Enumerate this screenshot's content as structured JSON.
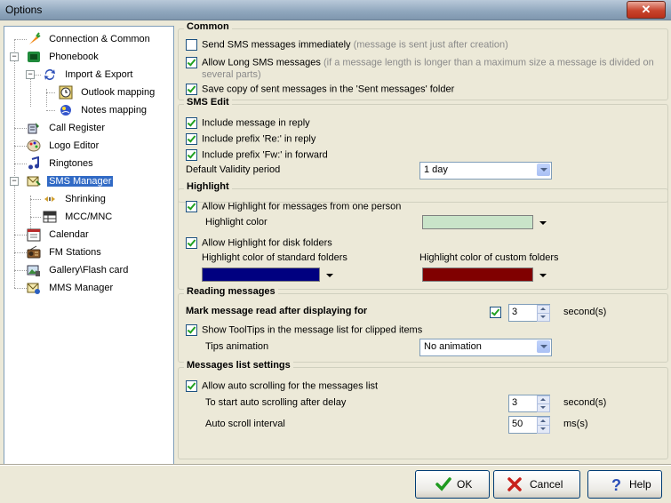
{
  "window": {
    "title": "Options",
    "close_label": "✕"
  },
  "tree": {
    "items": [
      {
        "label": "Connection & Common",
        "icon": "carrot-icon"
      },
      {
        "label": "Phonebook",
        "icon": "phonebook-icon"
      },
      {
        "label": "Import & Export",
        "icon": "sync-arrows-icon"
      },
      {
        "label": "Outlook mapping",
        "icon": "outlook-clock-icon"
      },
      {
        "label": "Notes mapping",
        "icon": "notes-globe-icon"
      },
      {
        "label": "Call Register",
        "icon": "call-register-icon"
      },
      {
        "label": "Logo Editor",
        "icon": "palette-icon"
      },
      {
        "label": "Ringtones",
        "icon": "music-note-icon"
      },
      {
        "label": "SMS Manager",
        "icon": "sms-manager-icon"
      },
      {
        "label": "Shrinking",
        "icon": "shrink-hands-icon"
      },
      {
        "label": "MCC/MNC",
        "icon": "network-table-icon"
      },
      {
        "label": "Calendar",
        "icon": "calendar-icon"
      },
      {
        "label": "FM Stations",
        "icon": "radio-icon"
      },
      {
        "label": "Gallery\\Flash card",
        "icon": "gallery-icon"
      },
      {
        "label": "MMS Manager",
        "icon": "mms-icon"
      }
    ],
    "selected": "SMS Manager"
  },
  "common": {
    "title": "Common",
    "send_immediately": "Send SMS messages immediately",
    "send_immediately_hint": "(message is sent just after creation)",
    "allow_long": "Allow Long SMS messages",
    "allow_long_hint1": "(if a message length is longer than a maximum size a message is divided on",
    "allow_long_hint2": "several parts)",
    "save_copy": "Save copy of sent messages in the 'Sent messages' folder"
  },
  "sms_edit": {
    "title": "SMS Edit",
    "include_message": "Include message in reply",
    "include_re": "Include prefix 'Re:' in reply",
    "include_fw": "Include prefix 'Fw:' in forward",
    "validity_label": "Default Validity period",
    "validity_value": "1 day"
  },
  "highlight": {
    "title": "Highlight",
    "allow_person": "Allow Highlight for messages from one person",
    "highlight_color_label": "Highlight color",
    "highlight_color": "#c9e4c9",
    "allow_disk": "Allow Highlight for disk folders",
    "standard_label": "Highlight color of standard folders",
    "standard_color": "#000080",
    "custom_label": "Highlight color of custom folders",
    "custom_color": "#800000"
  },
  "reading": {
    "title": "Reading messages",
    "mark_read": "Mark message read after displaying for",
    "mark_value": "3",
    "mark_unit": "second(s)",
    "show_tooltips": "Show ToolTips in the message list for clipped items",
    "tips_label": "Tips animation",
    "tips_value": "No animation"
  },
  "list_settings": {
    "title": "Messages list settings",
    "auto_scroll": "Allow auto scrolling for the messages list",
    "delay_label": "To start auto scrolling after delay",
    "delay_value": "3",
    "delay_unit": "second(s)",
    "interval_label": "Auto scroll interval",
    "interval_value": "50",
    "interval_unit": "ms(s)"
  },
  "buttons": {
    "ok": "OK",
    "cancel": "Cancel",
    "help": "Help"
  }
}
